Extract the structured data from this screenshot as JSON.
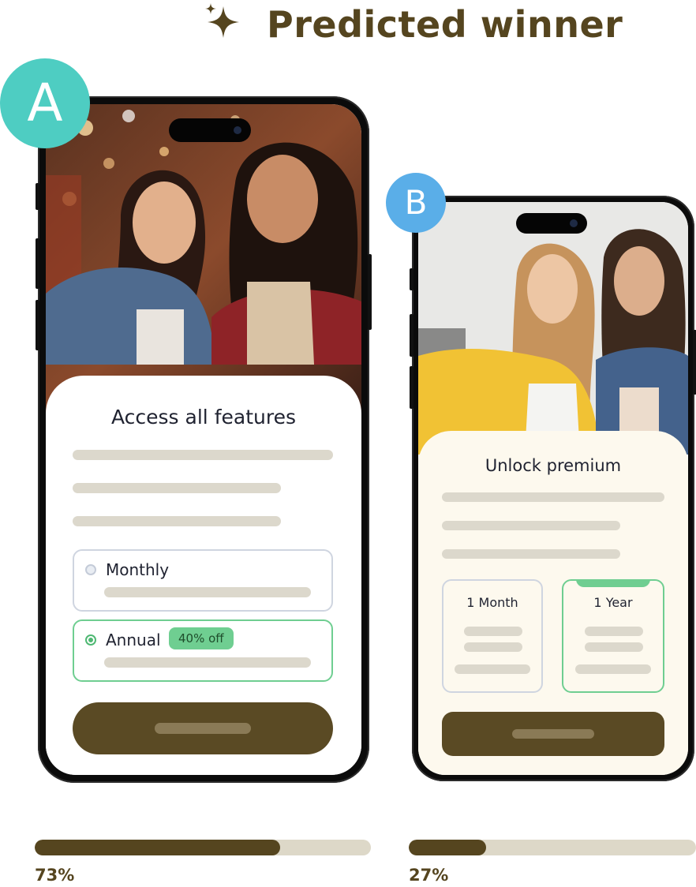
{
  "header": {
    "title": "Predicted winner",
    "icon": "sparkle-icon",
    "color": "#55451f"
  },
  "variants": [
    {
      "badge": "A",
      "badge_color": "#4ecdc2",
      "sheet_title": "Access all features",
      "plans": [
        {
          "label": "Monthly",
          "selected": false
        },
        {
          "label": "Annual",
          "selected": true,
          "badge": "40% off"
        }
      ],
      "progress": 0.73,
      "percent_label": "73%"
    },
    {
      "badge": "B",
      "badge_color": "#5aaee8",
      "sheet_title": "Unlock premium",
      "plans": [
        {
          "label": "1 Month",
          "selected": false
        },
        {
          "label": "1 Year",
          "selected": true
        }
      ],
      "progress": 0.27,
      "percent_label": "27%"
    }
  ],
  "colors": {
    "accent_green": "#6fce91",
    "cta": "#5a4a24",
    "track": "#ddd8c8"
  }
}
